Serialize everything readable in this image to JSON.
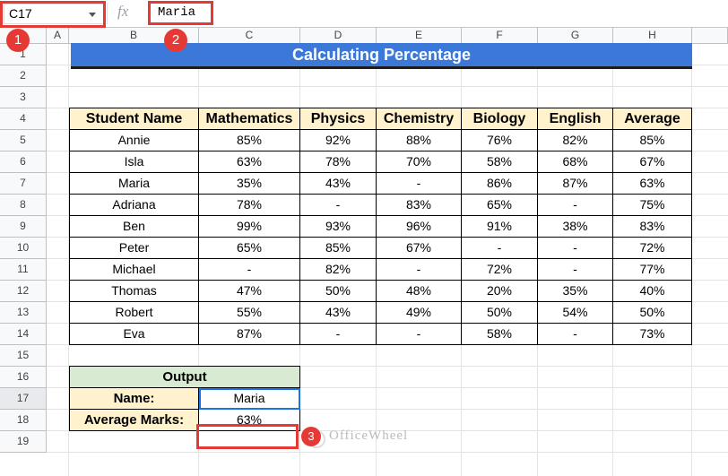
{
  "formula_bar": {
    "name_box": "C17",
    "fx_label": "fx",
    "content": "Maria"
  },
  "markers": [
    "1",
    "2",
    "3"
  ],
  "columns": [
    "A",
    "B",
    "C",
    "D",
    "E",
    "F",
    "G",
    "H"
  ],
  "rows": [
    "1",
    "2",
    "3",
    "4",
    "5",
    "6",
    "7",
    "8",
    "9",
    "10",
    "11",
    "12",
    "13",
    "14",
    "15",
    "16",
    "17",
    "18",
    "19"
  ],
  "selected_row": "17",
  "title": "Calculating Percentage",
  "table": {
    "headers": [
      "Student Name",
      "Mathematics",
      "Physics",
      "Chemistry",
      "Biology",
      "English",
      "Average"
    ],
    "rows": [
      [
        "Annie",
        "85%",
        "92%",
        "88%",
        "76%",
        "82%",
        "85%"
      ],
      [
        "Isla",
        "63%",
        "78%",
        "70%",
        "58%",
        "68%",
        "67%"
      ],
      [
        "Maria",
        "35%",
        "43%",
        "-",
        "86%",
        "87%",
        "63%"
      ],
      [
        "Adriana",
        "78%",
        "-",
        "83%",
        "65%",
        "-",
        "75%"
      ],
      [
        "Ben",
        "99%",
        "93%",
        "96%",
        "91%",
        "38%",
        "83%"
      ],
      [
        "Peter",
        "65%",
        "85%",
        "67%",
        "-",
        "-",
        "72%"
      ],
      [
        "Michael",
        "-",
        "82%",
        "-",
        "72%",
        "-",
        "77%"
      ],
      [
        "Thomas",
        "47%",
        "50%",
        "48%",
        "20%",
        "35%",
        "40%"
      ],
      [
        "Robert",
        "55%",
        "43%",
        "49%",
        "50%",
        "54%",
        "50%"
      ],
      [
        "Eva",
        "87%",
        "-",
        "-",
        "58%",
        "-",
        "73%"
      ]
    ]
  },
  "output": {
    "header": "Output",
    "name_label": "Name:",
    "name_value": "Maria",
    "avg_label": "Average Marks:",
    "avg_value": "63%"
  },
  "watermark": "OfficeWheel",
  "colors": {
    "title_bg": "#3c78d8",
    "header_bg": "#fff2cc",
    "output_header_bg": "#d9ead3",
    "highlight_red": "#e53935",
    "selection_blue": "#1a73e8"
  }
}
